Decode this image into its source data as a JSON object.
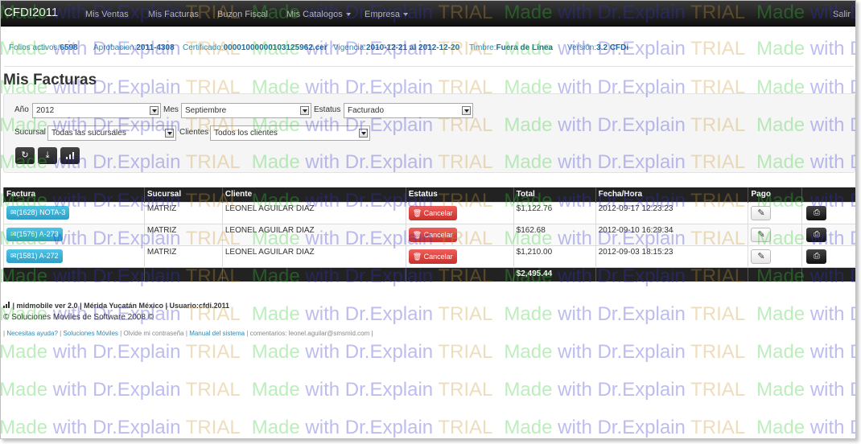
{
  "navbar": {
    "brand": "CFDI2011",
    "items": [
      {
        "label": "Mis Ventas",
        "dropdown": false
      },
      {
        "label": "Mis Facturas",
        "dropdown": false
      },
      {
        "label": "Buzon Fiscal",
        "dropdown": false
      },
      {
        "label": "Mis Catalogos",
        "dropdown": true
      },
      {
        "label": "Empresa",
        "dropdown": true
      }
    ],
    "logout": "Salir"
  },
  "info": {
    "folios_label": "Folios activos:",
    "folios_value": "6598",
    "aprobacion_label": "Aprobacion:",
    "aprobacion_value": "2011-4308",
    "certificado_label": "Certificado:",
    "certificado_value": "00001000000103125962.cer",
    "vigencia_label": "Vigencia:",
    "vigencia_value": "2010-12-21 al 2012-12-20",
    "timbre_label": "Timbre:",
    "timbre_value": "Fuera de Línea",
    "version_label": "Versión:",
    "version_value": "3.2 CFDi"
  },
  "page_title": "Mis Facturas",
  "filters": {
    "anio_label": "Año",
    "anio_value": "2012",
    "mes_label": "Mes",
    "mes_value": "Septiembre",
    "estatus_label": "Estatus",
    "estatus_value": "Facturado",
    "sucursal_label": "Sucursal",
    "sucursal_value": "Todas las sucursales",
    "clientes_label": "Clientes",
    "clientes_value": "Todos los clientes"
  },
  "table": {
    "headers": [
      "Factura",
      "Sucursal",
      "Cliente",
      "Estatus",
      "Total",
      "Fecha/Hora",
      "Pago",
      ""
    ],
    "rows": [
      {
        "factura": "(1628) NOTA-3",
        "sucursal": "MATRIZ",
        "cliente": "LEONEL AGUILAR DIAZ",
        "estatus": "Cancelar",
        "total": "$1,122.76",
        "fecha": "2012-09-17 12:23:23"
      },
      {
        "factura": "(1576) A-273",
        "sucursal": "MATRIZ",
        "cliente": "LEONEL AGUILAR DIAZ",
        "estatus": "Cancelar",
        "total": "$162.68",
        "fecha": "2012-09-10 16:29:34"
      },
      {
        "factura": "(1581) A-272",
        "sucursal": "MATRIZ",
        "cliente": "LEONEL AGUILAR DIAZ",
        "estatus": "Cancelar",
        "total": "$1,210.00",
        "fecha": "2012-09-03 18:15:23"
      }
    ],
    "grand_total": "$2,495.44"
  },
  "footer": {
    "line1": "| midmobile ver 2.0 | Mérida Yucatán México | Usuario:cfdi.2011",
    "line2": "© Soluciones Moviles de Software 2008 ©",
    "sep": "|",
    "help": "Necesitas ayuda?",
    "mobile": "Soluciones Móviles",
    "forgot": "Olvide mi contraseña",
    "manual": "Manual del sistema",
    "comments": "comentarios: leonel.aguilar@smsmid.com"
  },
  "watermark": {
    "made": "Made",
    "with": "with",
    "explain": "Dr.Explain",
    "trial": "TRIAL"
  }
}
